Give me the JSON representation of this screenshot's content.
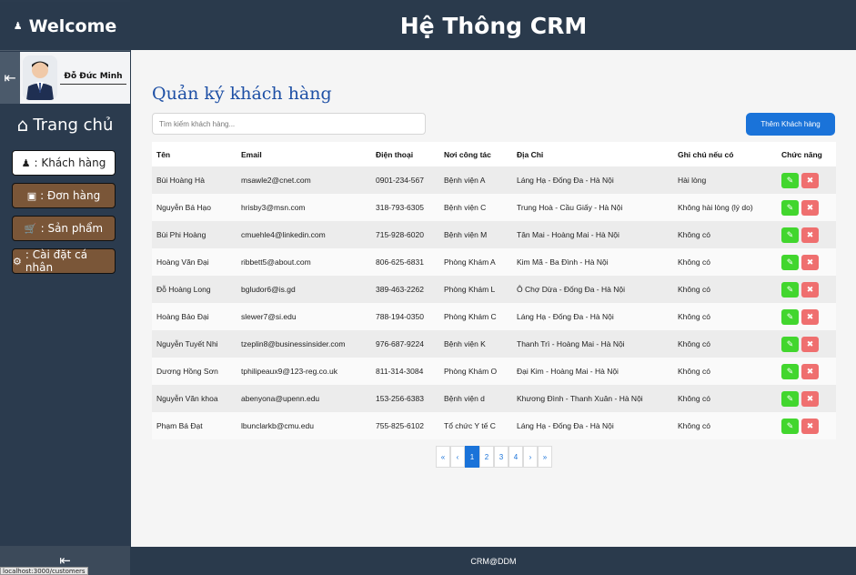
{
  "sidebar": {
    "welcome": "Welcome",
    "welcome_icon": "user-icon",
    "logout_icon": "logout-icon",
    "username": "Đỗ Đức Minh",
    "home_label": "Trang chủ",
    "home_icon": "home-icon",
    "nav": [
      {
        "label": ": Khách hàng",
        "icon": "user-icon",
        "active": true
      },
      {
        "label": ": Đơn hàng",
        "icon": "box-icon",
        "active": false
      },
      {
        "label": ": Sản phẩm",
        "icon": "cart-icon",
        "active": false
      },
      {
        "label": ": Cài đặt cá nhân",
        "icon": "gear-icon",
        "active": false
      }
    ],
    "status_url": "localhost:3000/customers"
  },
  "header": {
    "title": "Hệ Thông CRM"
  },
  "main": {
    "title": "Quản ký khách hàng",
    "search_placeholder": "Tìm kiếm khách hàng...",
    "add_button": "Thêm Khách hàng",
    "columns": [
      "Tên",
      "Email",
      "Điện thoại",
      "Nơi công tác",
      "Địa Chỉ",
      "Ghi chú nếu có",
      "Chức năng"
    ],
    "rows": [
      [
        "Bùi Hoàng Hà",
        "msawle2@cnet.com",
        "0901-234-567",
        "Bệnh viện A",
        "Láng Hạ - Đống Đa - Hà Nội",
        "Hài lòng"
      ],
      [
        "Nguyễn Bá Hạo",
        "hrisby3@msn.com",
        "318-793-6305",
        "Bệnh viện C",
        "Trung Hoà - Cầu Giấy - Hà Nội",
        "Không hài lòng (lý do)"
      ],
      [
        "Bùi Phi Hoàng",
        "cmuehle4@linkedin.com",
        "715-928-6020",
        "Bệnh viện M",
        "Tân Mai - Hoàng Mai - Hà Nội",
        "Không có"
      ],
      [
        "Hoàng Văn Đại",
        "ribbett5@about.com",
        "806-625-6831",
        "Phòng Khám A",
        "Kim Mã - Ba Đình - Hà Nội",
        "Không có"
      ],
      [
        "Đỗ Hoàng Long",
        "bgludor6@is.gd",
        "389-463-2262",
        "Phòng Khám L",
        "Ô Chợ Dừa - Đống Đa - Hà Nội",
        "Không có"
      ],
      [
        "Hoàng Bảo Đại",
        "slewer7@si.edu",
        "788-194-0350",
        "Phòng Khám C",
        "Láng Hạ - Đống Đa - Hà Nội",
        "Không có"
      ],
      [
        "Nguyễn Tuyết Nhi",
        "tzeplin8@businessinsider.com",
        "976-687-9224",
        "Bệnh viện K",
        "Thanh Trì - Hoàng Mai - Hà Nội",
        "Không có"
      ],
      [
        "Dương Hồng Sơn",
        "tphilipeaux9@123-reg.co.uk",
        "811-314-3084",
        "Phòng Khám O",
        "Đại Kim - Hoàng Mai - Hà Nội",
        "Không có"
      ],
      [
        "Nguyễn Văn khoa",
        "abenyona@upenn.edu",
        "153-256-6383",
        "Bệnh viện d",
        "Khương Đình - Thanh Xuân - Hà Nội",
        "Không có"
      ],
      [
        "Phạm Bá Đạt",
        "lbunclarkb@cmu.edu",
        "755-825-6102",
        "Tổ chức Y tế C",
        "Láng Hạ - Đống Đa - Hà Nội",
        "Không có"
      ]
    ],
    "pagination": [
      "«",
      "‹",
      "1",
      "2",
      "3",
      "4",
      "›",
      "»"
    ],
    "current_page": "1"
  },
  "footer": {
    "text": "CRM@DDM"
  },
  "colors": {
    "accent": "#1a73d9",
    "edit": "#42d62e",
    "delete": "#ef6f6f",
    "brown": "#7a5638",
    "navy": "#2a3a4c"
  }
}
